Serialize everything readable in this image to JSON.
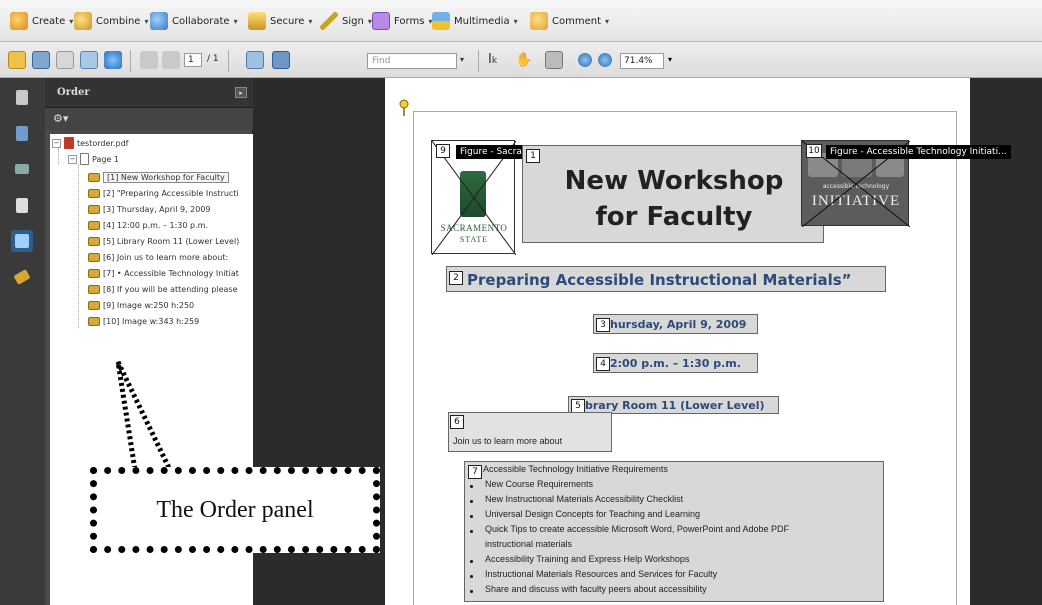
{
  "toolbar": {
    "create": "Create",
    "combine": "Combine",
    "collaborate": "Collaborate",
    "secure": "Secure",
    "sign": "Sign",
    "forms": "Forms",
    "multimedia": "Multimedia",
    "comment": "Comment"
  },
  "nav": {
    "current_page": "1",
    "total_pages": "/ 1",
    "find_placeholder": "Find",
    "zoom": "71.4%"
  },
  "panel": {
    "title": "Order",
    "file": "testorder.pdf",
    "page": "Page 1",
    "items": [
      "[1]  New Workshop for Faculty",
      "[2]  \"Preparing Accessible Instructi",
      "[3]  Thursday, April 9, 2009",
      "[4]  12:00 p.m. – 1:30 p.m.",
      "[5]  Library Room 11 (Lower Level)",
      "[6]  Join us to learn more about:",
      "[7]  • Accessible Technology Initiat",
      "[8]  If you will be attending please",
      "[9]  Image   w:250 h:250",
      "[10]  Image   w:343 h:259"
    ]
  },
  "callout": {
    "text": "The Order panel"
  },
  "document": {
    "fig1_label": "Figure - Sacramento State University",
    "fig2_label": "Figure - Accessible Technology Initiati...",
    "logo1_line1": "SACRAMENTO",
    "logo1_line2": "STATE",
    "logo2_line1": "accessible technology",
    "logo2_line2": "INITIATIVE",
    "headline1": "New Workshop",
    "headline2": "for Faculty",
    "subtitle": "Preparing Accessible Instructional Materials”",
    "date": "hursday, April 9, 2009",
    "time": "2:00 p.m. – 1:30 p.m.",
    "room": "brary Room 11 (Lower Level)",
    "join": "Join us to learn more about",
    "list": [
      "Accessible Technology Initiative Requirements",
      "New Course Requirements",
      "New Instructional Materials Accessibility Checklist",
      "Universal Design Concepts for Teaching and Learning",
      "Quick Tips to create accessible Microsoft Word, PowerPoint and Adobe PDF",
      "instructional materials",
      "Accessibility Training and Express Help Workshops",
      "Instructional Materials Resources and Services for Faculty",
      "Share and discuss with faculty peers about accessibility"
    ],
    "badges": [
      "9",
      "1",
      "10",
      "2",
      "3",
      "4",
      "5",
      "6",
      "7"
    ]
  }
}
